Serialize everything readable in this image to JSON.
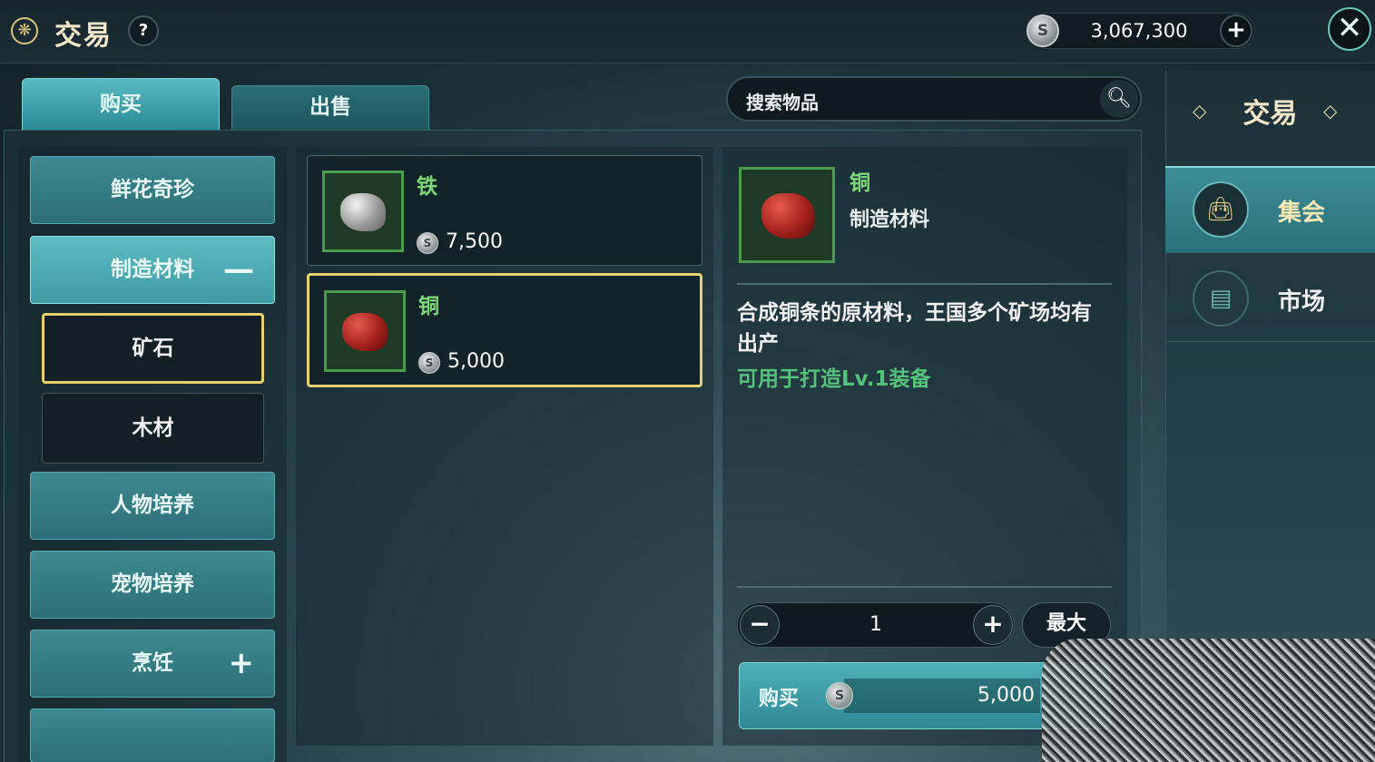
{
  "header": {
    "title": "交易",
    "help_label": "?",
    "currency_value": "3,067,300",
    "coin_symbol": "S",
    "plus_label": "+",
    "close_label": "✕"
  },
  "tabs": [
    {
      "label": "购买",
      "active": true
    },
    {
      "label": "出售",
      "active": false
    }
  ],
  "search": {
    "placeholder": "搜索物品"
  },
  "categories": [
    {
      "label": "鲜花奇珍"
    },
    {
      "label": "制造材料",
      "sign": "—",
      "expanded": true
    },
    {
      "label": "人物培养"
    },
    {
      "label": "宠物培养"
    },
    {
      "label": "烹饪",
      "sign": "+"
    }
  ],
  "subcategories": [
    {
      "label": "矿石",
      "selected": true
    },
    {
      "label": "木材"
    }
  ],
  "items": [
    {
      "name": "铁",
      "price": "7,500",
      "icon": "iron-ore"
    },
    {
      "name": "铜",
      "price": "5,000",
      "icon": "copper-ore",
      "selected": true
    }
  ],
  "detail": {
    "name": "铜",
    "category": "制造材料",
    "description": "合成铜条的原材料，王国多个矿场均有出产",
    "usage": "可用于打造Lv.1装备",
    "quantity": "1",
    "max_label": "最大",
    "minus_label": "−",
    "plus_label": "+",
    "buy_label": "购买",
    "buy_price": "5,000"
  },
  "sidebar": {
    "title": "交易",
    "items": [
      {
        "label": "集会",
        "icon": "bag-icon",
        "active": true
      },
      {
        "label": "市场",
        "icon": "shop-icon",
        "active": false
      }
    ]
  },
  "colors": {
    "accent": "#3f9aa3",
    "selected_border": "#e7d16c",
    "item_name": "#7ed87a",
    "usage_text": "#55c27c"
  }
}
